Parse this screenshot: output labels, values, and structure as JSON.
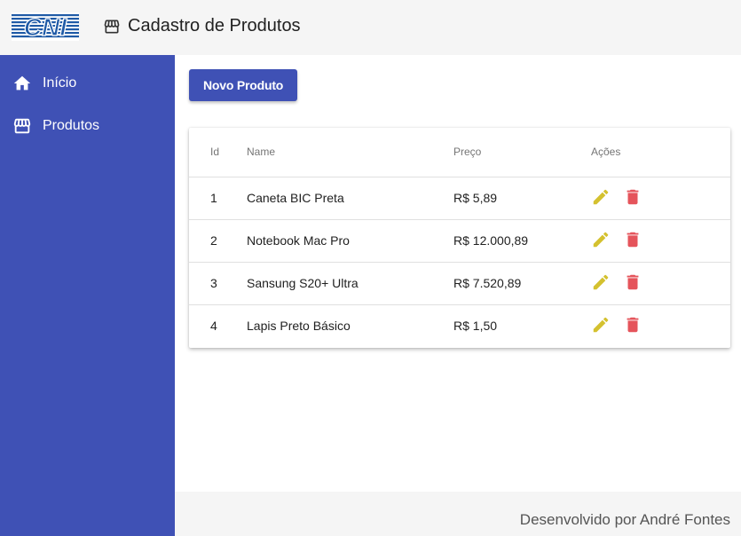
{
  "header": {
    "logo_text": "CNI",
    "title": "Cadastro de Produtos",
    "title_icon": "storefront-icon"
  },
  "sidebar": {
    "items": [
      {
        "label": "Início",
        "icon": "home-icon"
      },
      {
        "label": "Produtos",
        "icon": "storefront-icon"
      }
    ]
  },
  "main": {
    "new_button_label": "Novo Produto",
    "table": {
      "columns": [
        "Id",
        "Name",
        "Preço",
        "Ações"
      ],
      "rows": [
        {
          "id": "1",
          "name": "Caneta BIC Preta",
          "price": "R$ 5,89"
        },
        {
          "id": "2",
          "name": "Notebook Mac Pro",
          "price": "R$ 12.000,89"
        },
        {
          "id": "3",
          "name": "Sansung S20+ Ultra",
          "price": "R$ 7.520,89"
        },
        {
          "id": "4",
          "name": "Lapis Preto Básico",
          "price": "R$ 1,50"
        }
      ],
      "actions": [
        "pencil-icon",
        "trash-icon"
      ]
    }
  },
  "footer": {
    "text": "Desenvolvido por André Fontes"
  },
  "colors": {
    "primary": "#3f51b5",
    "edit": "#d4c12f",
    "delete": "#e5545b",
    "topbar_bg": "#f5f5f5"
  }
}
